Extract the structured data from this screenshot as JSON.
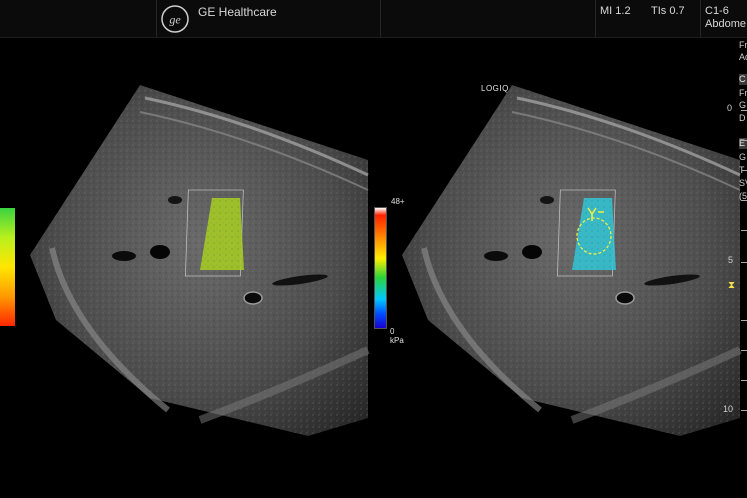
{
  "header": {
    "brand": "GE Healthcare",
    "mi": "MI 1.2",
    "tis": "TIs 0.7",
    "probe_line1": "C1-6",
    "probe_line2": "Abdome"
  },
  "image": {
    "logiq_label": "LOGIQ",
    "scale_max": "48+",
    "scale_min": "0",
    "scale_unit": "kPa"
  },
  "right_panel": {
    "items": [
      "Fr",
      "Ad",
      "C",
      "Fr",
      "G",
      "D",
      "E",
      "G",
      "T",
      "SV",
      "(5"
    ]
  },
  "depth_marks": {
    "d0": "0",
    "d5": "5",
    "d10": "10"
  },
  "colors": {
    "scale_top": "#ff2200",
    "scale_bottom": "#1a00d0",
    "roi_left": "#a8d020",
    "roi_right": "#30c8d8",
    "caliper": "#f0f040"
  }
}
